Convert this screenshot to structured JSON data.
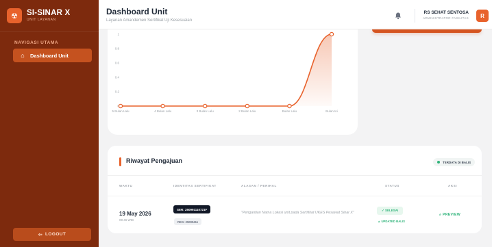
{
  "app": {
    "name": "SI-SINAR X",
    "subtitle": "UNIT LAYANAN",
    "logo_icon": "radiation-icon"
  },
  "sidebar": {
    "section_label": "NAVIGASI UTAMA",
    "items": [
      {
        "label": "Dashboard Unit",
        "icon": "home-icon",
        "active": true
      }
    ],
    "logout_label": "LOGOUT",
    "logout_icon": "logout-icon"
  },
  "header": {
    "title": "Dashboard Unit",
    "subtitle": "Layanan Amandemen Sertifikat Uji Kesesuaian",
    "notification_icon": "bell-icon",
    "user_name": "RS SEHAT SENTOSA",
    "user_role": "ADMINISTRATOR FASILITAS",
    "avatar_initial": "R"
  },
  "chart_data": {
    "type": "line",
    "categories": [
      "5 Bulan Lalu",
      "4 Bulan Lalu",
      "3 Bulan Lalu",
      "2 Bulan Lalu",
      "Bulan Lalu",
      "Bulan Ini"
    ],
    "values": [
      0,
      0,
      0,
      0,
      0,
      1
    ],
    "y_ticks": [
      "1",
      "0.8",
      "0.6",
      "0.4",
      "0.2",
      "0"
    ],
    "ylim": [
      0,
      1
    ],
    "color": "#e8622c",
    "area_fill": true,
    "grid": false
  },
  "history": {
    "title": "Riwayat Pengajuan",
    "badge": "TERDATA DI BALIS",
    "columns": [
      "WAKTU",
      "IDENTITAS SERTIFIKAT",
      "ALASAN / PERIHAL",
      "STATUS",
      "AKSI"
    ],
    "rows": [
      {
        "date": "19 May 2026",
        "time": "09:46 WIB",
        "ser": "SER: 250991110721F",
        "reg": "REG: 25099411",
        "reason": "\"Pengantian Nama Lokasi unit pada Sertifikat UKES Pesawat Sinar X\"",
        "status": "✓ SELESAI",
        "status_sub": "▲ UPDATED BALIS",
        "action": "PREVIEW",
        "action_icon": "search-icon"
      }
    ]
  },
  "colors": {
    "sidebar": "#7d2a0d",
    "accent": "#e8622c",
    "success": "#2fb37a"
  }
}
